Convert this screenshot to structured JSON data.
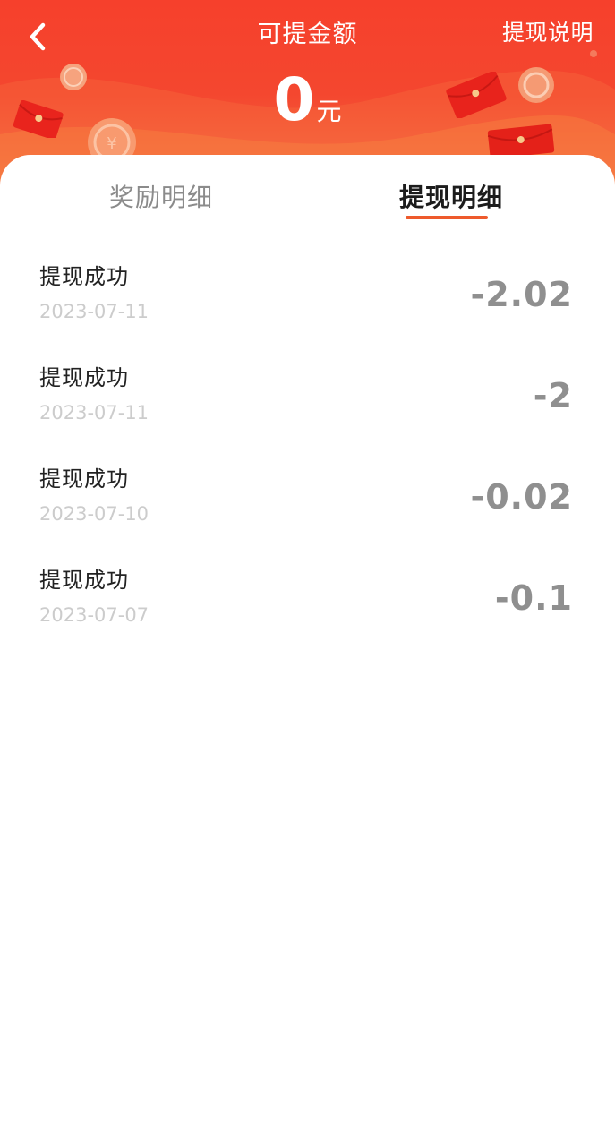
{
  "header": {
    "title": "可提金额",
    "help_label": "提现说明",
    "balance_value": "0",
    "balance_unit": "元"
  },
  "icons": {
    "back": "chevron-left-icon",
    "decor": [
      "red-envelope-icon",
      "coin-icon"
    ]
  },
  "tabs": [
    {
      "label": "奖励明细",
      "active": false
    },
    {
      "label": "提现明细",
      "active": true
    }
  ],
  "records": [
    {
      "title": "提现成功",
      "date": "2023-07-11",
      "amount": "-2.02"
    },
    {
      "title": "提现成功",
      "date": "2023-07-11",
      "amount": "-2"
    },
    {
      "title": "提现成功",
      "date": "2023-07-10",
      "amount": "-0.02"
    },
    {
      "title": "提现成功",
      "date": "2023-07-07",
      "amount": "-0.1"
    }
  ],
  "colors": {
    "header_red": "#f6402c",
    "header_orange": "#f7833f",
    "tab_active": "#1c1c1c",
    "tab_inactive": "#8b8b8b",
    "tab_underline": "#ee5a2c",
    "amount": "#8f8f8f",
    "date": "#cccccc"
  }
}
